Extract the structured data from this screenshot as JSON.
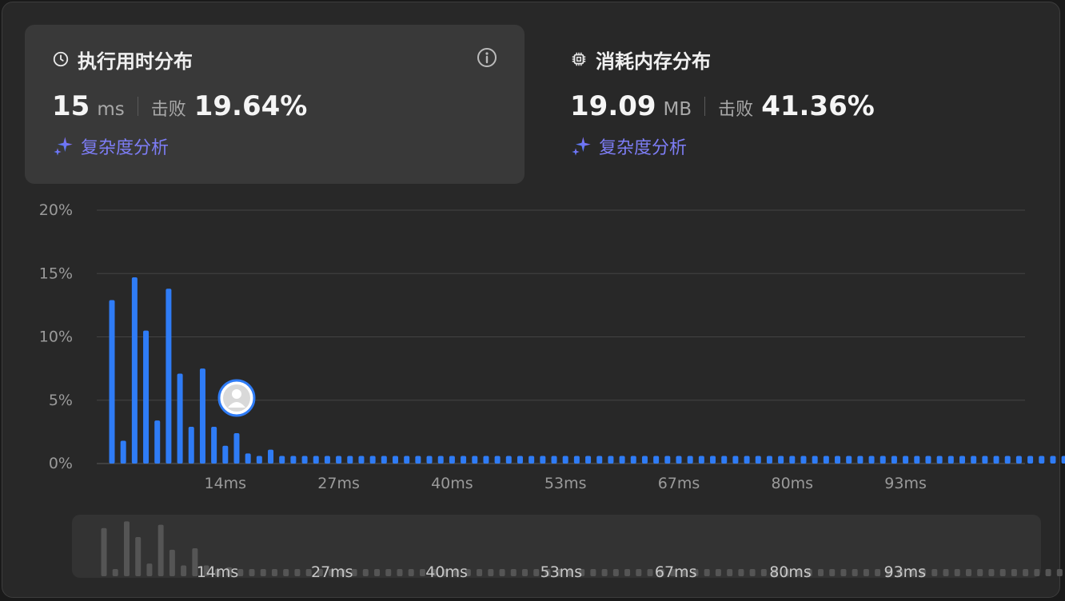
{
  "time_card": {
    "title": "执行用时分布",
    "value": "15",
    "unit": "ms",
    "beat_label": "击败",
    "beat_value": "19.64%",
    "link_label": "复杂度分析"
  },
  "memory_card": {
    "title": "消耗内存分布",
    "value": "19.09",
    "unit": "MB",
    "beat_label": "击败",
    "beat_value": "41.36%",
    "link_label": "复杂度分析"
  },
  "colors": {
    "bar": "#2f7cf6",
    "overview_bar": "#555555",
    "accent_link": "#7d7df5"
  },
  "icons": [
    "clock-icon",
    "info-icon",
    "chip-icon",
    "sparkle-icon",
    "avatar-icon"
  ],
  "chart_data": {
    "type": "bar",
    "y_ticks": [
      "20%",
      "15%",
      "10%",
      "5%",
      "0%"
    ],
    "ylim": [
      0,
      20
    ],
    "x_tick_labels": [
      "14ms",
      "27ms",
      "40ms",
      "53ms",
      "67ms",
      "80ms",
      "93ms"
    ],
    "values": [
      12.9,
      1.8,
      14.7,
      10.5,
      3.4,
      13.8,
      7.1,
      2.9,
      7.5,
      2.9,
      1.4,
      2.4,
      0.8,
      0.6,
      1.1,
      0.6,
      0.6,
      0.6,
      0.6,
      0.6,
      0.6,
      0.6,
      0.6,
      0.6,
      0.6,
      0.6,
      0.6,
      0.6,
      0.6,
      0.6,
      0.6,
      0.6,
      0.6,
      0.6,
      0.6,
      0.6,
      0.6,
      0.6,
      0.6,
      0.6,
      0.6,
      0.6,
      0.6,
      0.6,
      0.6,
      0.6,
      0.6,
      0.6,
      0.6,
      0.6,
      0.6,
      0.6,
      0.6,
      0.6,
      0.6,
      0.6,
      0.6,
      0.6,
      0.6,
      0.6,
      0.6,
      0.6,
      0.6,
      0.6,
      0.6,
      0.6,
      0.6,
      0.6,
      0.6,
      0.6,
      0.6,
      0.6,
      0.6,
      0.6,
      0.6,
      0.6,
      0.6,
      0.6,
      0.6,
      0.6,
      0.6,
      0.6,
      0.6,
      0.6,
      0.6,
      0.6,
      0.6,
      0.6,
      0.6,
      0.6,
      0.6,
      0.6,
      0.6,
      0.6,
      0.6,
      0.6,
      0.6,
      0.6,
      0.6
    ],
    "user_bar_index": 11,
    "grid": true
  }
}
